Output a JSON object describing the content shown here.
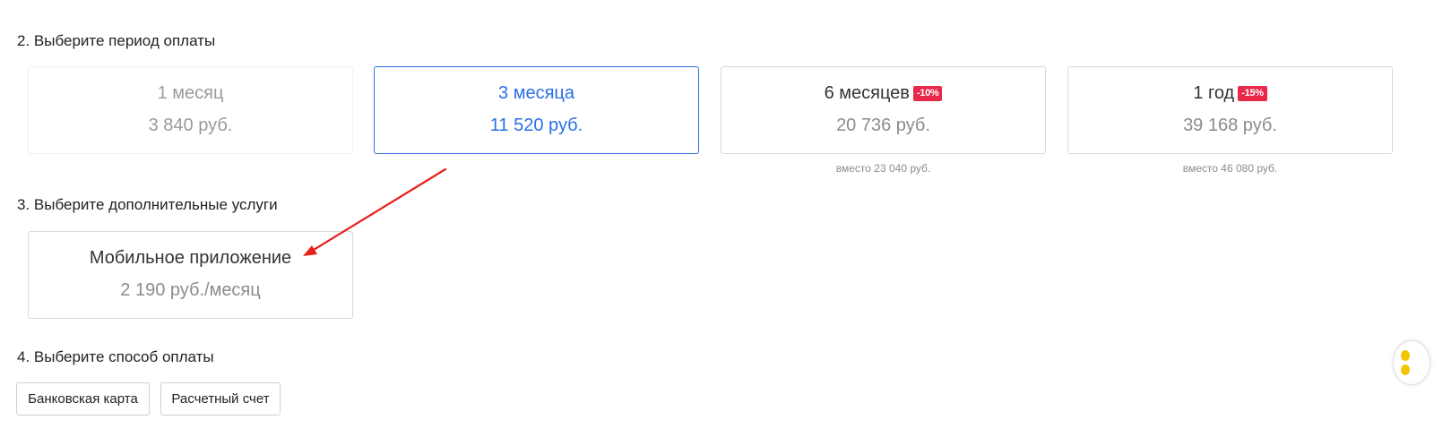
{
  "sections": {
    "period_title": "2. Выберите период оплаты",
    "addons_title": "3. Выберите дополнительные услуги",
    "payment_title": "4. Выберите способ оплаты"
  },
  "periods": [
    {
      "name": "1 месяц",
      "price": "3 840 руб.",
      "badge": "",
      "note": "",
      "state": "faded"
    },
    {
      "name": "3 месяца",
      "price": "11 520 руб.",
      "badge": "",
      "note": "",
      "state": "selected"
    },
    {
      "name": "6 месяцев",
      "price": "20 736 руб.",
      "badge": "-10%",
      "note": "вместо 23 040 руб.",
      "state": "default"
    },
    {
      "name": "1 год",
      "price": "39 168 руб.",
      "badge": "-15%",
      "note": "вместо 46 080 руб.",
      "state": "default"
    }
  ],
  "addons": [
    {
      "name": "Мобильное приложение",
      "price": "2 190 руб./месяц"
    }
  ],
  "payment_methods": [
    {
      "label": "Банковская карта"
    },
    {
      "label": "Расчетный счет"
    }
  ],
  "colors": {
    "accent": "#2a6ee8",
    "badge": "#e8294a",
    "annotation_arrow": "#e8201c",
    "widget": "#f4c400"
  },
  "icons": {
    "annotation": "red-arrow-annotation",
    "edge_widget": "chat-widget-icon"
  }
}
